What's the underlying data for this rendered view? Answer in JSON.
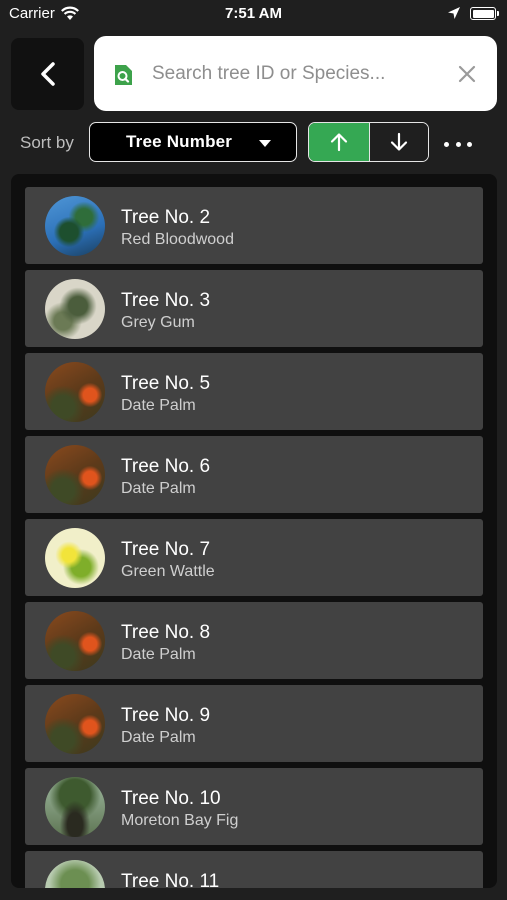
{
  "status_bar": {
    "carrier": "Carrier",
    "time": "7:51 AM"
  },
  "search": {
    "placeholder": "Search tree ID or Species...",
    "value": ""
  },
  "sort": {
    "label": "Sort by",
    "selected": "Tree Number",
    "order": "ascending"
  },
  "colors": {
    "accent": "#35a853",
    "card": "#424242",
    "background": "#1f1f1f"
  },
  "trees": [
    {
      "title": "Tree No. 2",
      "species": "Red Bloodwood",
      "image": "bloodwood"
    },
    {
      "title": "Tree No. 3",
      "species": "Grey Gum",
      "image": "greygum"
    },
    {
      "title": "Tree No. 5",
      "species": "Date Palm",
      "image": "datepalm"
    },
    {
      "title": "Tree No. 6",
      "species": "Date Palm",
      "image": "datepalm"
    },
    {
      "title": "Tree No. 7",
      "species": "Green Wattle",
      "image": "wattle"
    },
    {
      "title": "Tree No. 8",
      "species": "Date Palm",
      "image": "datepalm"
    },
    {
      "title": "Tree No. 9",
      "species": "Date Palm",
      "image": "datepalm"
    },
    {
      "title": "Tree No. 10",
      "species": "Moreton Bay Fig",
      "image": "fig"
    },
    {
      "title": "Tree No. 11",
      "species": "",
      "image": "generic"
    }
  ]
}
